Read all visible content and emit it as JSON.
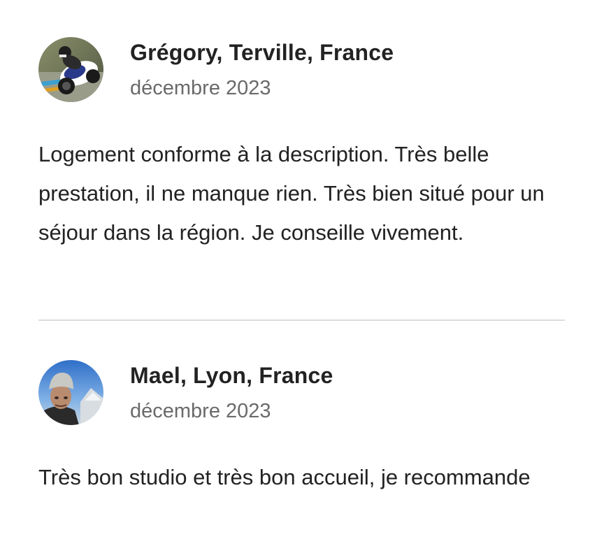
{
  "reviews": [
    {
      "author": "Grégory, Terville, France",
      "date": "décembre 2023",
      "text": "Logement conforme à la description. Très belle prestation, il ne manque rien. Très bien situé pour un séjour dans la région. Je conseille vivement.",
      "avatar_icon": "motorcycle-rider-photo"
    },
    {
      "author": "Mael, Lyon, France",
      "date": "décembre 2023",
      "text": "Très bon studio et très bon accueil, je recommande",
      "avatar_icon": "person-portrait-photo"
    }
  ],
  "colors": {
    "primary_text": "#222222",
    "secondary_text": "#6a6a6a",
    "divider": "#dddddd"
  }
}
